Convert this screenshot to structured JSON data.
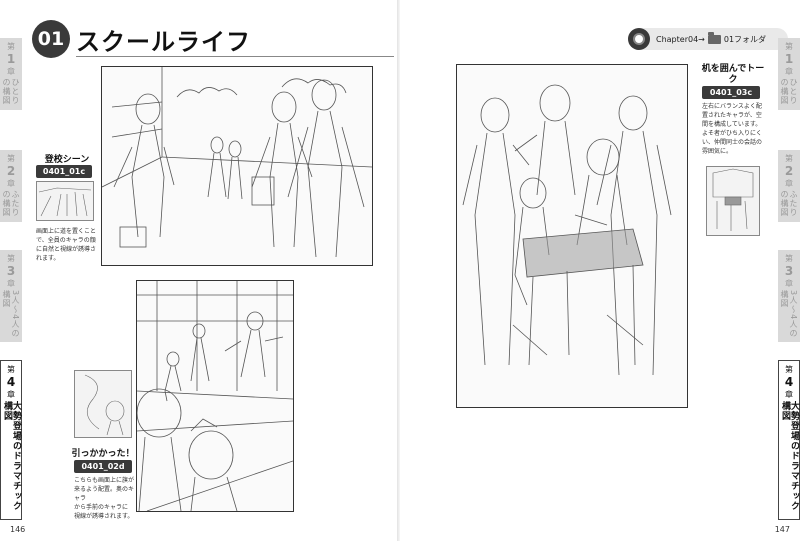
{
  "left_page": {
    "section_number": "01",
    "section_title": "スクールライフ",
    "page_number": "146"
  },
  "right_page": {
    "chapter_path": {
      "chapter": "Chapter04",
      "arrow": "→",
      "folder": "01フォルダ"
    },
    "page_number": "147"
  },
  "chapter_tabs": [
    {
      "prefix": "第",
      "num": "1",
      "suffix": "章",
      "title": "ひとりの構図"
    },
    {
      "prefix": "第",
      "num": "2",
      "suffix": "章",
      "title": "ふたりの構図"
    },
    {
      "prefix": "第",
      "num": "3",
      "suffix": "章",
      "title": "3人〜4人の構図"
    },
    {
      "prefix": "第",
      "num": "4",
      "suffix": "章",
      "title": "大勢登場のドラマチック構図"
    }
  ],
  "captions": {
    "c01c": {
      "title": "登校シーン",
      "code": "0401_01c",
      "text": [
        "画面上に道を置くことで、全員のキャラの顔",
        "に自然と視線が誘導さ",
        "れます。"
      ]
    },
    "c02d": {
      "title": "引っかかった！",
      "code": "0401_02d",
      "text": [
        "こちらも画面上に旗が",
        "来るよう配置。奥のキャラ",
        "から手前のキャラに",
        "視線が誘導されます。"
      ]
    },
    "c03c": {
      "title": "机を囲んでトーク",
      "code": "0401_03c",
      "text": [
        "左右にバランスよく配",
        "置されたキャラが、空",
        "間を構成しています。",
        "よそ者がひち入りにく",
        "い、仲間同士の会話の",
        "雰囲気に。"
      ]
    }
  }
}
